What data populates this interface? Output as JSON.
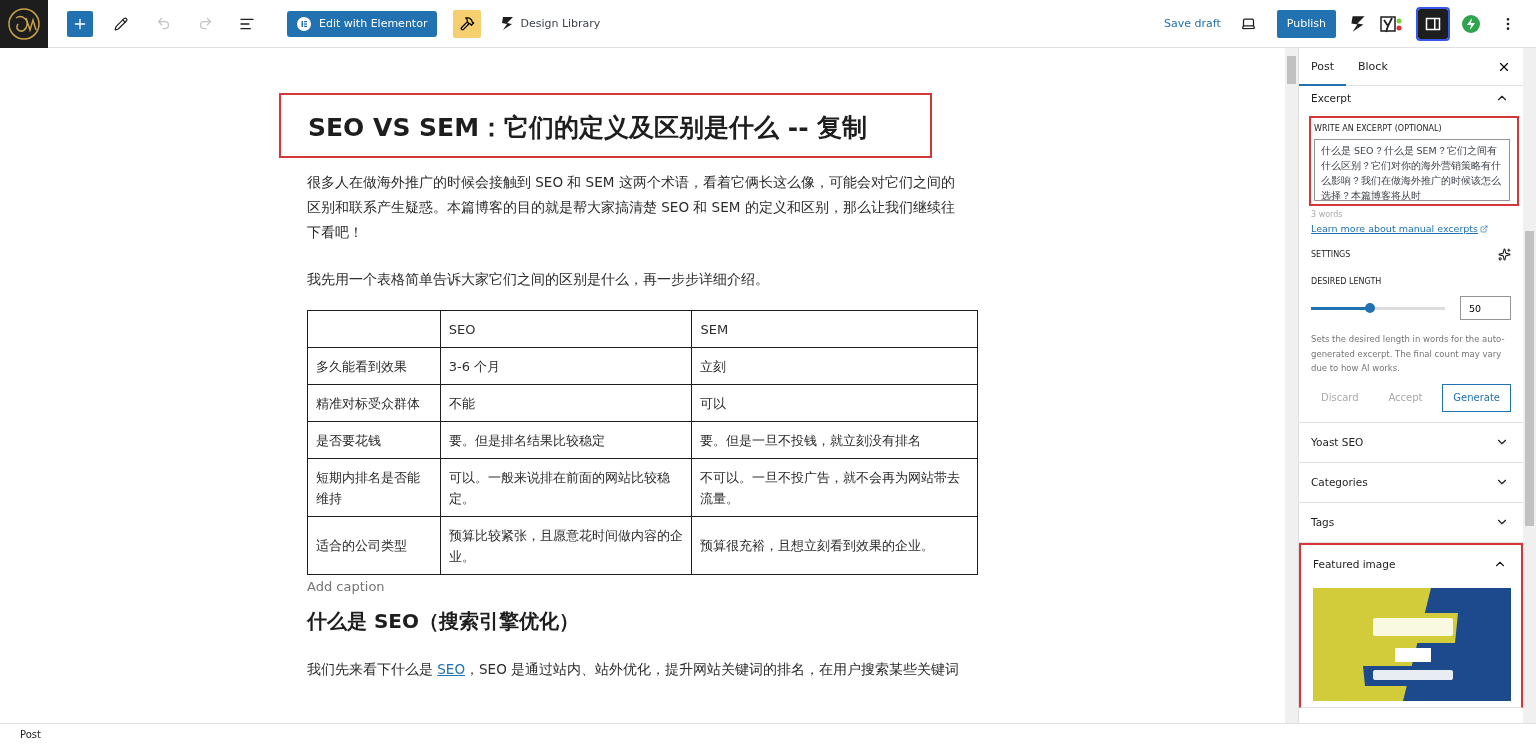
{
  "toolbar": {
    "undo": {
      "disabled": true
    },
    "redo": {
      "disabled": true
    },
    "elementor_button": {
      "label": "Edit with Elementor"
    },
    "design_library": {
      "label": "Design Library"
    },
    "save_draft": {
      "label": "Save draft"
    },
    "publish": {
      "label": "Publish"
    },
    "sidebar_toggle": {
      "selected": true
    }
  },
  "editor": {
    "title": {
      "text": "SEO VS SEM：它们的定义及区别是什么 -- 复制",
      "highlighted": true
    },
    "blocks": [
      {
        "kind": "paragraph",
        "parts": [
          {
            "text": "很多人在做海外推广的时候会接触到 SEO 和 SEM 这两个术语，看着它俩长这么像，可能会对它们之间的区别和联系产生疑惑。本篇博客的目的就是帮大家搞清楚 SEO 和 SEM 的定义和区别，那么让我们继续往下看吧！"
          }
        ]
      },
      {
        "kind": "paragraph",
        "parts": [
          {
            "text": "我先用一个表格简单告诉大家它们之间的区别是什么，再一步步详细介绍。"
          }
        ]
      },
      {
        "kind": "table",
        "rows": [
          [
            "",
            "SEO",
            "SEM"
          ],
          [
            "多久能看到效果",
            "3-6 个月",
            "立刻"
          ],
          [
            "精准对标受众群体",
            "不能",
            "可以"
          ],
          [
            "是否要花钱",
            "要。但是排名结果比较稳定",
            "要。但是一旦不投钱，就立刻没有排名"
          ],
          [
            "短期内排名是否能维持",
            "可以。一般来说排在前面的网站比较稳定。",
            "不可以。一旦不投广告，就不会再为网站带去流量。"
          ],
          [
            "适合的公司类型",
            "预算比较紧张，且愿意花时间做内容的企业。",
            "预算很充裕，且想立刻看到效果的企业。"
          ]
        ],
        "caption_placeholder": "Add caption"
      },
      {
        "kind": "heading",
        "parts": [
          {
            "text": "什么是 SEO（搜索引擎优化）"
          }
        ]
      },
      {
        "kind": "paragraph",
        "parts": [
          {
            "text": "我们先来看下什么是 "
          },
          {
            "text": "SEO",
            "link": true
          },
          {
            "text": "，SEO 是通过站内、站外优化，提升网站关键词的排名，在用户搜索某些关键词"
          }
        ]
      }
    ]
  },
  "sidebar": {
    "tabs": [
      {
        "label": "Post",
        "selected": true
      },
      {
        "label": "Block",
        "selected": false
      }
    ],
    "panels": [
      {
        "kind": "excerpt",
        "title": "Excerpt",
        "expanded": true,
        "highlighted": true,
        "field_label": "WRITE AN EXCERPT (OPTIONAL)",
        "value": "什么是 SEO？什么是 SEM？它们之间有什么区别？它们对你的海外营销策略有什么影响？我们在做海外推广的时候该怎么选择？本篇博客将从时",
        "word_count": "3 words",
        "link": "Learn more about manual excerpts",
        "settings_label": "SETTINGS",
        "length_label": "DESIRED LENGTH",
        "slider": {
          "level": 0.44
        },
        "length_value": "50",
        "help": "Sets the desired length in words for the auto-generated excerpt. The final count may vary due to how AI works.",
        "actions": [
          {
            "label": "Discard",
            "kind": "text"
          },
          {
            "label": "Accept",
            "kind": "text"
          },
          {
            "label": "Generate",
            "kind": "outline"
          }
        ]
      },
      {
        "kind": "plain",
        "title": "Yoast SEO",
        "expanded": false,
        "highlighted": false
      },
      {
        "kind": "plain",
        "title": "Categories",
        "expanded": false,
        "highlighted": false
      },
      {
        "kind": "plain",
        "title": "Tags",
        "expanded": false,
        "highlighted": false
      },
      {
        "title": "Featured image",
        "expanded": true,
        "highlighted": true
      }
    ]
  },
  "status_bar": {
    "breadcrumb": "Post"
  }
}
